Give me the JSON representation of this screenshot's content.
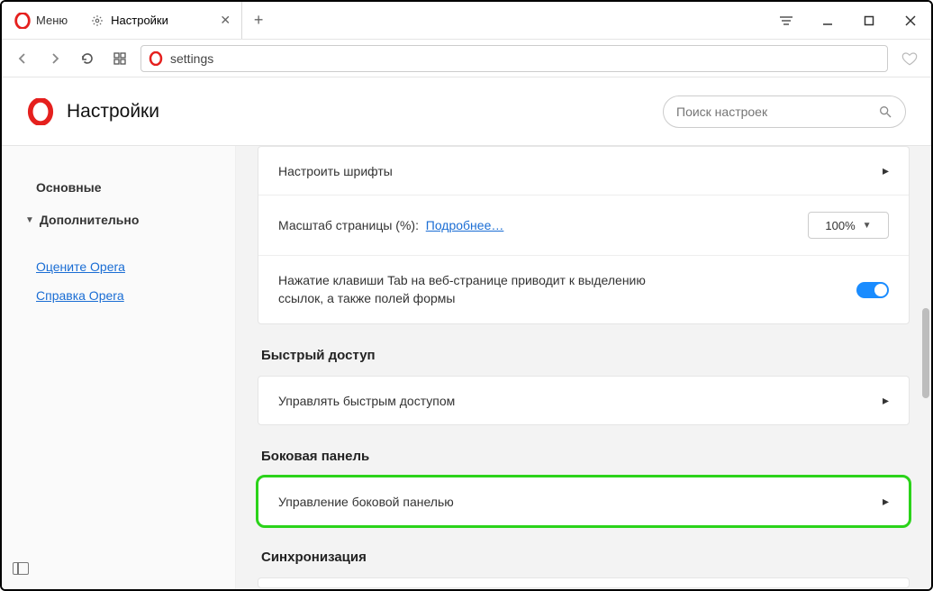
{
  "window": {
    "menu_label": "Меню"
  },
  "tab": {
    "title": "Настройки"
  },
  "address": {
    "value": "settings"
  },
  "header": {
    "title": "Настройки",
    "search_placeholder": "Поиск настроек"
  },
  "sidebar": {
    "basic": "Основные",
    "advanced": "Дополнительно",
    "rate": "Оцените Opera",
    "help": "Справка Opera"
  },
  "settings": {
    "fonts_row": "Настроить шрифты",
    "zoom_label": "Масштаб страницы (%):",
    "zoom_more": "Подробнее…",
    "zoom_value": "100%",
    "tab_focus": "Нажатие клавиши Tab на веб-странице приводит к выделению ссылок, а также полей формы",
    "speed_dial_title": "Быстрый доступ",
    "speed_dial_manage": "Управлять быстрым доступом",
    "sidebar_title": "Боковая панель",
    "sidebar_manage": "Управление боковой панелью",
    "sync_title": "Синхронизация"
  }
}
